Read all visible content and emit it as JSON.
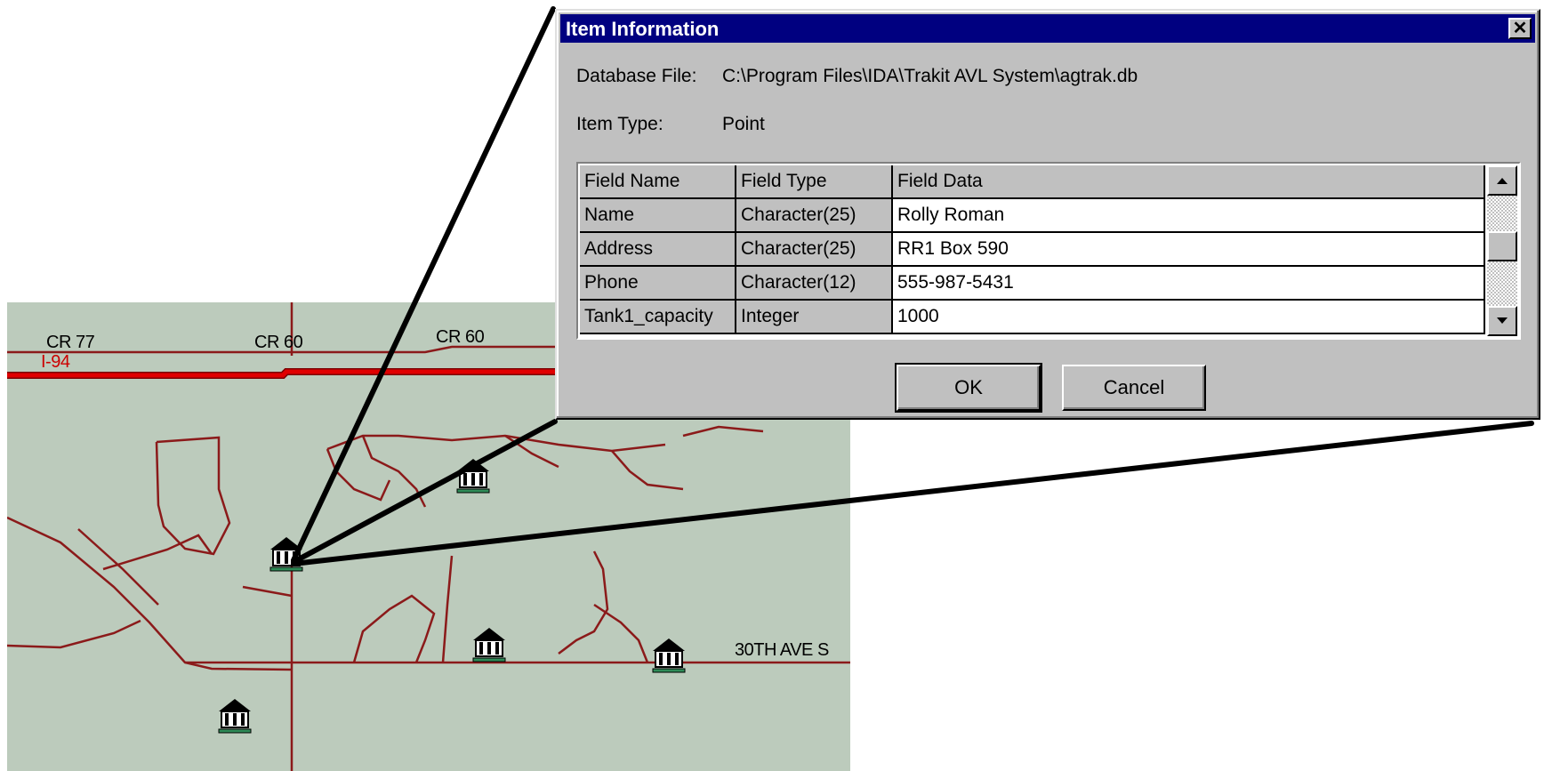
{
  "dialog": {
    "title": "Item Information",
    "close_glyph": "✕",
    "database_file_label": "Database File:",
    "database_file_value": "C:\\Program Files\\IDA\\Trakit AVL System\\agtrak.db",
    "item_type_label": "Item Type:",
    "item_type_value": "Point",
    "grid": {
      "headers": [
        "Field Name",
        "Field Type",
        "Field Data"
      ],
      "rows": [
        [
          "Name",
          "Character(25)",
          "Rolly Roman"
        ],
        [
          "Address",
          "Character(25)",
          "RR1 Box 590"
        ],
        [
          "Phone",
          "Character(12)",
          "555-987-5431"
        ],
        [
          "Tank1_capacity",
          "Integer",
          "1000"
        ]
      ]
    },
    "ok_label": "OK",
    "cancel_label": "Cancel"
  },
  "map": {
    "background": "#bccbbc",
    "road_color": "#8b1a1a",
    "highway_color": "#e00000",
    "labels": {
      "cr77": "CR 77",
      "i94": "I-94",
      "cr60_a": "CR 60",
      "cr60_b": "CR 60",
      "ave30": "30TH AVE S"
    },
    "icon": "farm-building-icon"
  }
}
